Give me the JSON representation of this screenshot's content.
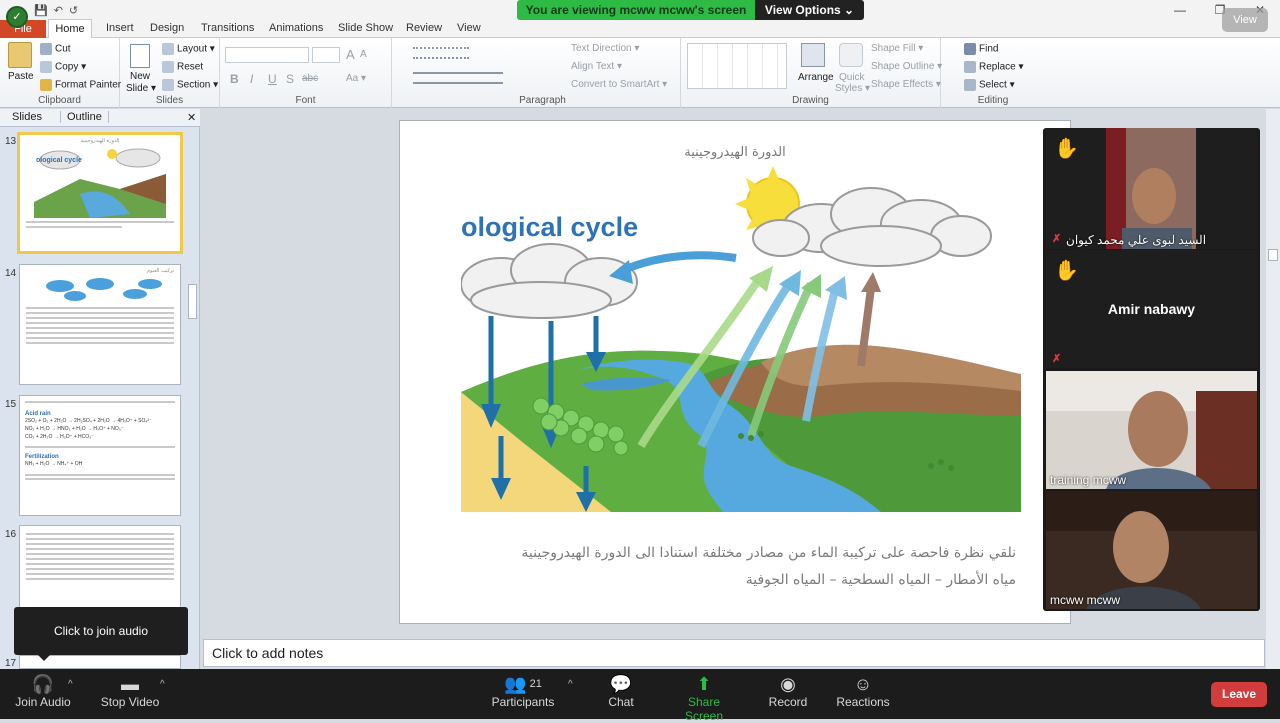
{
  "qat": {
    "save": "💾",
    "undo": "↶",
    "redo": "↺"
  },
  "window": {
    "min": "—",
    "max": "❐",
    "close": "✕"
  },
  "banner": {
    "text": "You are viewing mcww mcww's screen",
    "view_options": "View Options ⌄"
  },
  "view_button": "View",
  "tabs": {
    "file": "File",
    "home": "Home",
    "insert": "Insert",
    "design": "Design",
    "transitions": "Transitions",
    "animations": "Animations",
    "slideshow": "Slide Show",
    "review": "Review",
    "view": "View"
  },
  "ribbon": {
    "clipboard": {
      "paste": "Paste",
      "cut": "Cut",
      "copy": "Copy ▾",
      "format_painter": "Format Painter",
      "label": "Clipboard"
    },
    "slides": {
      "new_slide": "New",
      "new_slide2": "Slide ▾",
      "layout": "Layout ▾",
      "reset": "Reset",
      "section": "Section ▾",
      "label": "Slides"
    },
    "font": {
      "label": "Font",
      "bold": "B",
      "italic": "I",
      "underline": "U",
      "strike": "S",
      "abc": "abc",
      "aa": "Aa ▾",
      "grow": "A",
      "shrink": "A"
    },
    "paragraph": {
      "label": "Paragraph",
      "text_direction": "Text Direction ▾",
      "align_text": "Align Text ▾",
      "smartart": "Convert to SmartArt ▾"
    },
    "drawing": {
      "label": "Drawing",
      "arrange": "Arrange",
      "quick_styles": "Quick",
      "quick_styles2": "Styles ▾",
      "shape_fill": "Shape Fill ▾",
      "shape_outline": "Shape Outline ▾",
      "shape_effects": "Shape Effects ▾"
    },
    "editing": {
      "label": "Editing",
      "find": "Find",
      "replace": "Replace ▾",
      "select": "Select ▾"
    }
  },
  "panel": {
    "tab_slides": "Slides",
    "tab_outline": "Outline",
    "close": "✕"
  },
  "thumbs": [
    {
      "num": "13",
      "title": "الدورة الهيدروجينية",
      "label": "ological cycle"
    },
    {
      "num": "14",
      "title": "تركيب الغيوم"
    },
    {
      "num": "15",
      "title": "Acid rain",
      "lines": [
        "2SO₂ + O₂ + 2H₂O → 2H₂SO₄ + 2H₂O → 4H₃O⁺ + SO₄²⁻",
        "NO₂ + H₂O → HNO₃ + H₂O → H₃O⁺ + NO₃⁻",
        "CO₂ + 2H₂O → H₃O⁺ + HCO₃⁻"
      ],
      "sub": "Fertilization",
      "sub_line": "NH₃ + H₂O → NH₄⁺ + OH"
    },
    {
      "num": "16"
    },
    {
      "num": "17"
    }
  ],
  "tooltip": "Click to join audio",
  "slide": {
    "title": "الدورة الهيدروجينية",
    "diagram_label": "ological cycle",
    "body1": "نلقي نظرة فاحصة على تركيبة الماء من مصادر مختلفة استنادا الى الدورة الهيدروجينية",
    "body2": "مياه الأمطار – المياه السطحية – المياه الجوفية"
  },
  "notes_placeholder": "Click to add notes",
  "participants": [
    {
      "name": "السيد لبوى علي محمد كيوان",
      "hand": "✋",
      "muted": true
    },
    {
      "name": "Amir nabawy",
      "hand": "✋",
      "muted": true
    },
    {
      "name": "training mcww"
    },
    {
      "name": "mcww mcww"
    }
  ],
  "toolbar": {
    "join_audio": "Join Audio",
    "stop_video": "Stop Video",
    "participants": "Participants",
    "participants_count": "21",
    "chat": "Chat",
    "share_screen": "Share Screen",
    "record": "Record",
    "reactions": "Reactions",
    "leave": "Leave"
  },
  "colors": {
    "accent_green": "#2dbb46",
    "file_tab": "#d24726",
    "leave": "#d13c3c",
    "share": "#2dbb46"
  }
}
